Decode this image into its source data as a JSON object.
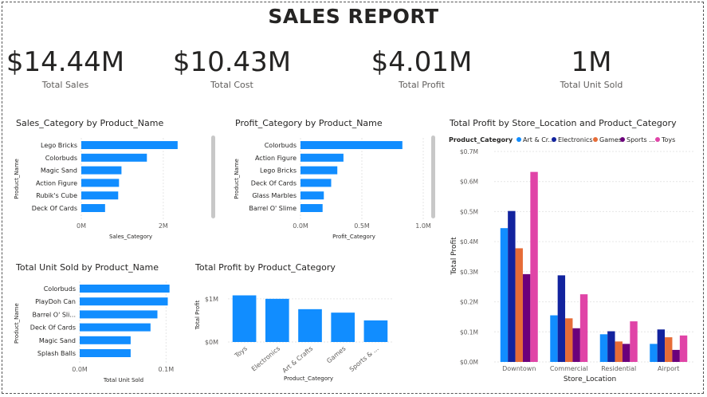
{
  "title": "SALES REPORT",
  "kpis": [
    {
      "value": "$14.44M",
      "label": "Total Sales"
    },
    {
      "value": "$10.43M",
      "label": "Total Cost"
    },
    {
      "value": "$4.01M",
      "label": "Total Profit"
    },
    {
      "value": "1M",
      "label": "Total Unit Sold"
    }
  ],
  "colors": {
    "bar": "#118DFF",
    "grid": "#e6e6e6",
    "axis_text": "#605e5c"
  },
  "chart_data": [
    {
      "id": "sales",
      "type": "bar",
      "orientation": "horizontal",
      "title": "Sales_Category by Product_Name",
      "ylabel": "Product_Name",
      "xlabel": "Sales_Category",
      "categories": [
        "Lego Bricks",
        "Colorbuds",
        "Magic Sand",
        "Action Figure",
        "Rubik's Cube",
        "Deck Of Cards"
      ],
      "values": [
        2.35,
        1.6,
        0.98,
        0.92,
        0.9,
        0.58
      ],
      "value_unit": "M",
      "xlim": [
        0,
        2.8
      ],
      "xticks": [
        {
          "v": 0,
          "label": "0M"
        },
        {
          "v": 2,
          "label": "2M"
        }
      ]
    },
    {
      "id": "profit",
      "type": "bar",
      "orientation": "horizontal",
      "title": "Profit_Category by Product_Name",
      "ylabel": "Product_Name",
      "xlabel": "Profit_Category",
      "categories": [
        "Colorbuds",
        "Action Figure",
        "Lego Bricks",
        "Deck Of Cards",
        "Glass Marbles",
        "Barrel O' Slime"
      ],
      "values": [
        0.83,
        0.35,
        0.3,
        0.25,
        0.19,
        0.18
      ],
      "value_unit": "M",
      "xlim": [
        0,
        1.0
      ],
      "xticks": [
        {
          "v": 0,
          "label": "0.0M"
        },
        {
          "v": 0.5,
          "label": "0.5M"
        },
        {
          "v": 1.0,
          "label": "1.0M"
        }
      ]
    },
    {
      "id": "units",
      "type": "bar",
      "orientation": "horizontal",
      "title": "Total Unit Sold by Product_Name",
      "ylabel": "Product_Name",
      "xlabel": "Total Unit Sold",
      "categories": [
        "Colorbuds",
        "PlayDoh Can",
        "Barrel O' Sli...",
        "Deck Of Cards",
        "Magic Sand",
        "Splash Balls"
      ],
      "values": [
        0.104,
        0.102,
        0.09,
        0.082,
        0.059,
        0.059
      ],
      "value_unit": "M",
      "xlim": [
        0,
        0.12
      ],
      "xticks": [
        {
          "v": 0,
          "label": "0.0M"
        },
        {
          "v": 0.1,
          "label": "0.1M"
        }
      ]
    },
    {
      "id": "profit_cat",
      "type": "bar",
      "orientation": "vertical",
      "title": "Total Profit by Product_Category",
      "ylabel": "Total Profit",
      "xlabel": "Product_Category",
      "categories": [
        "Toys",
        "Electronics",
        "Art & Crafts",
        "Games",
        "Sports & ..."
      ],
      "values": [
        1.08,
        1.0,
        0.76,
        0.68,
        0.5
      ],
      "value_unit": "M",
      "ylim": [
        0,
        1.2
      ],
      "yticks": [
        {
          "v": 0,
          "label": "$0M"
        },
        {
          "v": 1,
          "label": "$1M"
        }
      ]
    },
    {
      "id": "store",
      "type": "bar",
      "orientation": "vertical",
      "grouped": true,
      "title": "Total Profit by Store_Location and Product_Category",
      "legend_title": "Product_Category",
      "legend_position": "top",
      "ylabel": "Total Profit",
      "xlabel": "Store_Location",
      "categories": [
        "Downtown",
        "Commercial",
        "Residential",
        "Airport"
      ],
      "ylim": [
        0,
        0.7
      ],
      "yticks": [
        {
          "v": 0,
          "label": "$0.0M"
        },
        {
          "v": 0.1,
          "label": "$0.1M"
        },
        {
          "v": 0.2,
          "label": "$0.2M"
        },
        {
          "v": 0.3,
          "label": "$0.3M"
        },
        {
          "v": 0.4,
          "label": "$0.4M"
        },
        {
          "v": 0.5,
          "label": "$0.5M"
        },
        {
          "v": 0.6,
          "label": "$0.6M"
        },
        {
          "v": 0.7,
          "label": "$0.7M"
        }
      ],
      "series": [
        {
          "name": "Art & Cr...",
          "color": "#118DFF",
          "values": [
            0.445,
            0.155,
            0.092,
            0.06
          ]
        },
        {
          "name": "Electronics",
          "color": "#12239E",
          "values": [
            0.502,
            0.288,
            0.102,
            0.108
          ]
        },
        {
          "name": "Games",
          "color": "#E66C37",
          "values": [
            0.378,
            0.145,
            0.068,
            0.082
          ]
        },
        {
          "name": "Sports ...",
          "color": "#6B007B",
          "values": [
            0.292,
            0.112,
            0.06,
            0.04
          ]
        },
        {
          "name": "Toys",
          "color": "#E044A7",
          "values": [
            0.632,
            0.225,
            0.135,
            0.088
          ]
        }
      ]
    }
  ]
}
